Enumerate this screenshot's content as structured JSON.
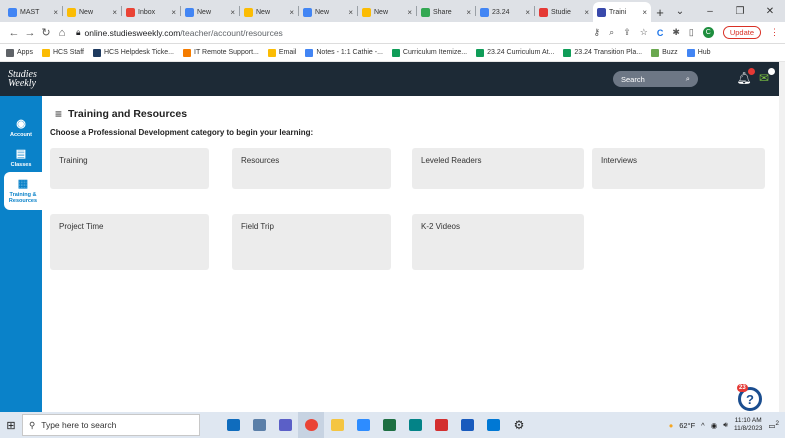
{
  "browser": {
    "tabs": [
      {
        "label": "MAST",
        "color": "#4285f4"
      },
      {
        "label": "New",
        "color": "#fbbc04"
      },
      {
        "label": "Inbox",
        "color": "#ea4335"
      },
      {
        "label": "New",
        "color": "#4285f4"
      },
      {
        "label": "New",
        "color": "#fbbc04"
      },
      {
        "label": "New",
        "color": "#4285f4"
      },
      {
        "label": "New",
        "color": "#fbbc04"
      },
      {
        "label": "Share",
        "color": "#34a853"
      },
      {
        "label": "23.24",
        "color": "#4285f4"
      },
      {
        "label": "Studie",
        "color": "#e53935"
      },
      {
        "label": "Traini",
        "color": "#3949ab"
      }
    ],
    "url_host": "online.studiesweekly.com",
    "url_path": "/teacher/account/resources",
    "profile_initial": "C",
    "update_label": "Update",
    "bookmarks": [
      {
        "label": "Apps",
        "color": "#5f6368"
      },
      {
        "label": "HCS Staff",
        "color": "#fbbc04"
      },
      {
        "label": "HCS Helpdesk Ticke...",
        "color": "#1e3a5f"
      },
      {
        "label": "IT Remote Support...",
        "color": "#f57c00"
      },
      {
        "label": "Email",
        "color": "#fbbc04"
      },
      {
        "label": "Notes - 1:1 Cathie -...",
        "color": "#4285f4"
      },
      {
        "label": "Curriculum Itemize...",
        "color": "#0f9d58"
      },
      {
        "label": "23.24 Curriculum At...",
        "color": "#0f9d58"
      },
      {
        "label": "23.24 Transition Pla...",
        "color": "#0f9d58"
      },
      {
        "label": "Buzz",
        "color": "#6aa84f"
      },
      {
        "label": "Hub",
        "color": "#4285f4"
      }
    ]
  },
  "app": {
    "logo_line1": "Studies",
    "logo_line2": "Weekly",
    "search_placeholder": "Search",
    "sidebar": [
      {
        "label": "Account",
        "icon": "A"
      },
      {
        "label": "Classes",
        "icon": "▤"
      },
      {
        "label": "Training & Resources",
        "icon": "▦"
      }
    ],
    "page_title": "Training and Resources",
    "subtitle": "Choose a Professional Development category to begin your learning:",
    "categories": [
      "Training",
      "Resources",
      "Leveled Readers",
      "Interviews",
      "Project Time",
      "Field Trip",
      "K-2 Videos"
    ],
    "help_badge": "23"
  },
  "taskbar": {
    "search_placeholder": "Type here to search",
    "weather": "62°F",
    "time": "11:10 AM",
    "date": "11/8/2023",
    "notif_count": "2"
  }
}
